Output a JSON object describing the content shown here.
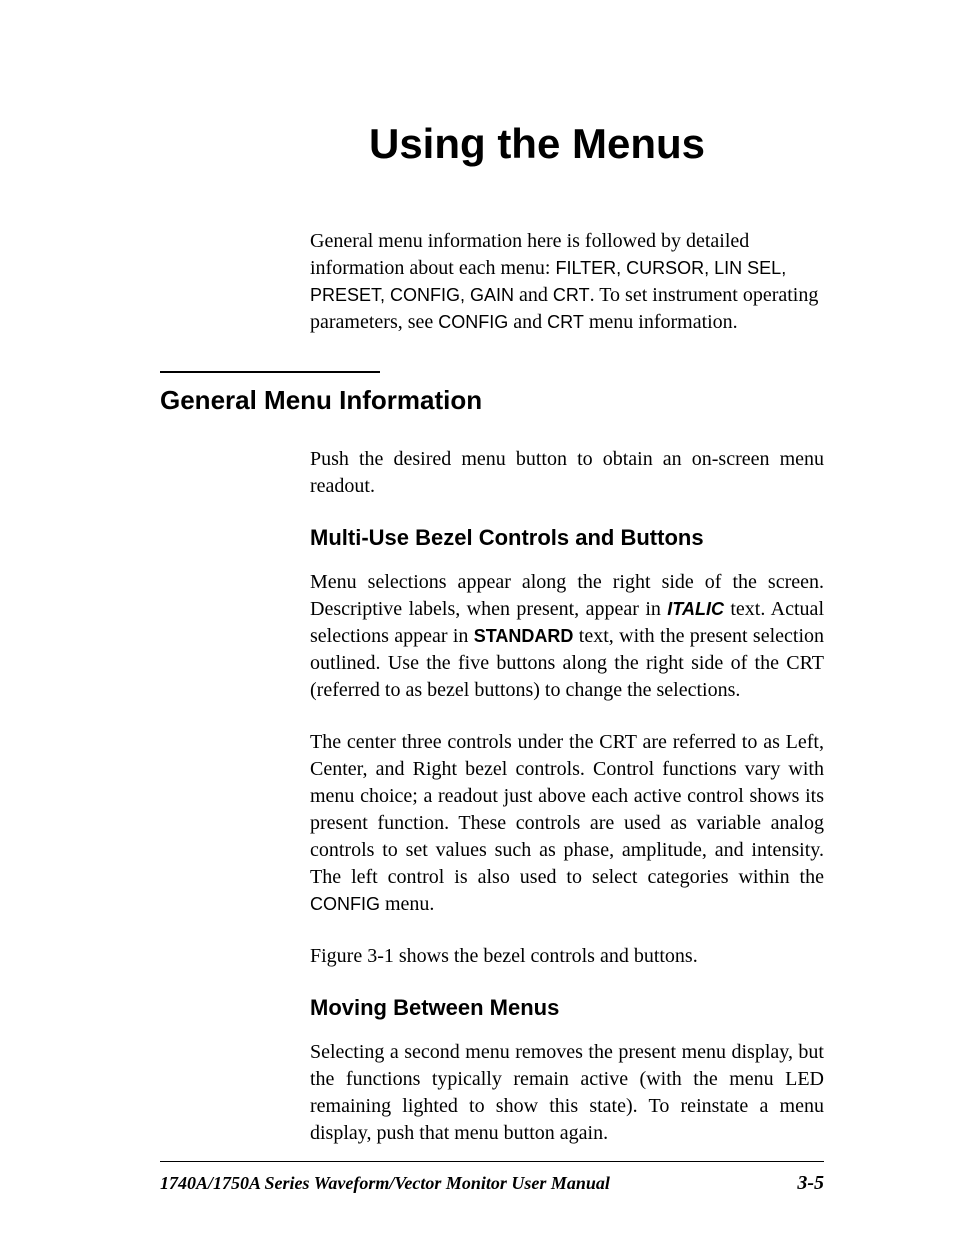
{
  "title": "Using the Menus",
  "intro": {
    "part1": "General menu information here is followed by detailed information about each menu: ",
    "menus": "FILTER, CURSOR, LIN SEL, PRESET, CONFIG, GAIN",
    "part2": " and ",
    "crt": "CRT",
    "part3": ".   To set instrument operating parameters, see ",
    "config": "CONFIG",
    "part4": " and ",
    "crt2": "CRT",
    "part5": " menu information."
  },
  "section1": {
    "heading": "General Menu Information",
    "para1": "Push the desired menu button to obtain an on-screen menu readout."
  },
  "subsection1": {
    "heading": "Multi-Use Bezel Controls and Buttons",
    "p1a": "Menu selections appear along the right side of the screen. Descriptive labels, when present, appear in ",
    "italic": "ITALIC",
    "p1b": " text.  Actual selections appear in ",
    "standard": "STANDARD",
    "p1c": " text, with the present selection outlined. Use the five buttons along the right side of the CRT (referred to as bezel buttons) to change the selections.",
    "p2a": "The center three controls under the CRT are referred to as Left, Center, and Right bezel controls.  Control functions vary with menu choice; a readout just above each active control shows its present function.  These controls are used as variable analog controls to set values such as phase, amplitude, and intensity.  The left control is also used to select categories within the ",
    "config": "CONFIG",
    "p2b": " menu.",
    "p3": "Figure 3-1 shows the bezel controls and buttons."
  },
  "subsection2": {
    "heading": "Moving Between Menus",
    "p1": "Selecting a second menu removes the present menu display, but the functions typically remain active (with the menu LED remaining lighted to show this state).  To reinstate a menu display, push that menu button again."
  },
  "footer": {
    "title": "1740A/1750A Series Waveform/Vector Monitor User Manual",
    "page": "3-5"
  }
}
